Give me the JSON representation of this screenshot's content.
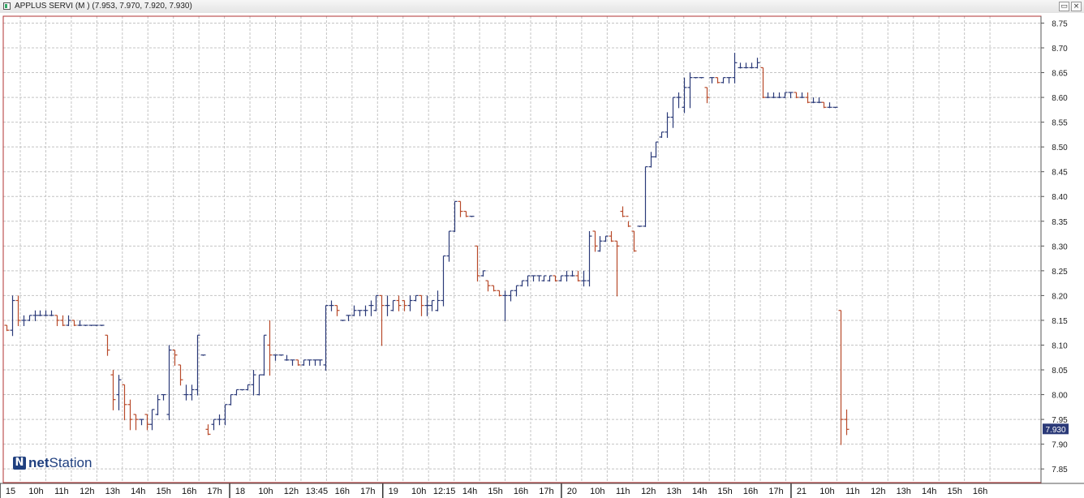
{
  "window": {
    "title": "APPLUS SERVI (M ) (7.953, 7.970, 7.920, 7.930)",
    "buttons": {
      "restore": "▭",
      "close": "×"
    }
  },
  "logo": {
    "part1": "net",
    "part2": "Station"
  },
  "colors": {
    "up": "#2b3a78",
    "down": "#b84a2a",
    "grid": "#c4c4c4",
    "frame": "#b03030",
    "last_price_bg": "#2b3a78",
    "last_price_text": "#ffffff"
  },
  "chart_data": {
    "type": "ohlc",
    "grid": true,
    "ylim": [
      7.83,
      8.77
    ],
    "yticks": [
      "7.85",
      "7.90",
      "7.95",
      "8.00",
      "8.05",
      "8.10",
      "8.15",
      "8.20",
      "8.25",
      "8.30",
      "8.35",
      "8.40",
      "8.45",
      "8.50",
      "8.55",
      "8.60",
      "8.65",
      "8.70",
      "8.75"
    ],
    "xlabels": [
      "15",
      "10h",
      "11h",
      "12h",
      "13h",
      "14h",
      "15h",
      "16h",
      "17h",
      "18",
      "10h",
      "12h",
      "13:45",
      "16h",
      "17h",
      "19",
      "10h",
      "12:15",
      "14h",
      "15h",
      "16h",
      "17h",
      "20",
      "10h",
      "11h",
      "12h",
      "13h",
      "14h",
      "15h",
      "16h",
      "17h",
      "21",
      "10h",
      "11h",
      "12h",
      "13h",
      "14h",
      "15h",
      "16h"
    ],
    "last_price": "7.930",
    "bars": [
      [
        8.14,
        8.14,
        8.13,
        8.13
      ],
      [
        8.13,
        8.2,
        8.12,
        8.19
      ],
      [
        8.19,
        8.2,
        8.14,
        8.15
      ],
      [
        8.15,
        8.16,
        8.14,
        8.15
      ],
      [
        8.15,
        8.16,
        8.15,
        8.16
      ],
      [
        8.16,
        8.17,
        8.15,
        8.16
      ],
      [
        8.16,
        8.17,
        8.16,
        8.16
      ],
      [
        8.16,
        8.17,
        8.16,
        8.16
      ],
      [
        8.16,
        8.17,
        8.16,
        8.16
      ],
      [
        8.16,
        8.16,
        8.14,
        8.15
      ],
      [
        8.15,
        8.16,
        8.14,
        8.14
      ],
      [
        8.14,
        8.16,
        8.14,
        8.15
      ],
      [
        8.15,
        8.15,
        8.14,
        8.14
      ],
      [
        8.14,
        8.15,
        8.14,
        8.14
      ],
      [
        8.14,
        8.14,
        8.14,
        8.14
      ],
      [
        8.14,
        8.14,
        8.14,
        8.14
      ],
      [
        8.14,
        8.14,
        8.14,
        8.14
      ],
      [
        8.14,
        8.14,
        8.14,
        8.14
      ],
      [
        8.12,
        8.12,
        8.08,
        8.09
      ],
      [
        8.04,
        8.05,
        7.97,
        7.99
      ],
      [
        8.0,
        8.04,
        7.97,
        8.03
      ],
      [
        8.02,
        8.02,
        7.95,
        7.98
      ],
      [
        7.98,
        7.99,
        7.93,
        7.95
      ],
      [
        7.96,
        7.96,
        7.93,
        7.95
      ],
      [
        7.95,
        7.95,
        7.94,
        7.95
      ],
      [
        7.96,
        7.96,
        7.93,
        7.94
      ],
      [
        7.94,
        7.97,
        7.93,
        7.97
      ],
      [
        7.96,
        8.0,
        7.96,
        7.99
      ],
      [
        8.0,
        8.0,
        7.99,
        8.0
      ],
      [
        7.96,
        8.1,
        7.95,
        8.09
      ],
      [
        8.09,
        8.09,
        8.06,
        8.08
      ],
      [
        8.06,
        8.06,
        8.02,
        8.03
      ],
      [
        8.0,
        8.02,
        7.99,
        8.0
      ],
      [
        8.0,
        8.02,
        7.99,
        8.01
      ],
      [
        8.01,
        8.12,
        8.0,
        8.12
      ],
      [
        8.08,
        8.08,
        8.08,
        8.08
      ],
      [
        7.93,
        7.94,
        7.92,
        7.92
      ],
      [
        7.94,
        7.95,
        7.93,
        7.95
      ],
      [
        7.95,
        7.96,
        7.94,
        7.95
      ],
      [
        7.95,
        7.98,
        7.94,
        7.98
      ],
      [
        7.98,
        8.0,
        7.98,
        8.0
      ],
      [
        8.0,
        8.01,
        8.0,
        8.01
      ],
      [
        8.01,
        8.01,
        8.01,
        8.01
      ],
      [
        8.01,
        8.02,
        8.01,
        8.02
      ],
      [
        8.02,
        8.05,
        8.0,
        8.04
      ],
      [
        8.0,
        8.04,
        8.0,
        8.04
      ],
      [
        8.04,
        8.12,
        8.04,
        8.12
      ],
      [
        8.1,
        8.15,
        8.04,
        8.08
      ],
      [
        8.08,
        8.08,
        8.07,
        8.08
      ],
      [
        8.08,
        8.08,
        8.08,
        8.08
      ],
      [
        8.07,
        8.08,
        8.07,
        8.07
      ],
      [
        8.07,
        8.07,
        8.06,
        8.07
      ],
      [
        8.07,
        8.07,
        8.06,
        8.06
      ],
      [
        8.06,
        8.07,
        8.06,
        8.07
      ],
      [
        8.07,
        8.07,
        8.06,
        8.07
      ],
      [
        8.07,
        8.07,
        8.06,
        8.07
      ],
      [
        8.07,
        8.07,
        8.06,
        8.07
      ],
      [
        8.06,
        8.18,
        8.05,
        8.18
      ],
      [
        8.18,
        8.19,
        8.17,
        8.18
      ],
      [
        8.18,
        8.18,
        8.16,
        8.17
      ],
      [
        8.15,
        8.15,
        8.15,
        8.15
      ],
      [
        8.16,
        8.16,
        8.15,
        8.16
      ],
      [
        8.16,
        8.18,
        8.16,
        8.17
      ],
      [
        8.17,
        8.17,
        8.16,
        8.17
      ],
      [
        8.17,
        8.18,
        8.16,
        8.17
      ],
      [
        8.18,
        8.19,
        8.16,
        8.18
      ],
      [
        8.17,
        8.2,
        8.17,
        8.2
      ],
      [
        8.2,
        8.2,
        8.1,
        8.18
      ],
      [
        8.18,
        8.2,
        8.16,
        8.18
      ],
      [
        8.17,
        8.19,
        8.17,
        8.19
      ],
      [
        8.19,
        8.2,
        8.17,
        8.18
      ],
      [
        8.19,
        8.19,
        8.17,
        8.18
      ],
      [
        8.18,
        8.2,
        8.17,
        8.19
      ],
      [
        8.19,
        8.2,
        8.19,
        8.2
      ],
      [
        8.2,
        8.2,
        8.16,
        8.18
      ],
      [
        8.18,
        8.2,
        8.16,
        8.18
      ],
      [
        8.18,
        8.19,
        8.17,
        8.19
      ],
      [
        8.17,
        8.21,
        8.17,
        8.19
      ],
      [
        8.19,
        8.28,
        8.18,
        8.28
      ],
      [
        8.28,
        8.33,
        8.27,
        8.33
      ],
      [
        8.33,
        8.39,
        8.33,
        8.39
      ],
      [
        8.39,
        8.39,
        8.36,
        8.37
      ],
      [
        8.37,
        8.37,
        8.36,
        8.36
      ],
      [
        8.36,
        8.36,
        8.36,
        8.36
      ],
      [
        8.3,
        8.3,
        8.23,
        8.24
      ],
      [
        8.24,
        8.25,
        8.24,
        8.25
      ],
      [
        8.23,
        8.23,
        8.21,
        8.22
      ],
      [
        8.22,
        8.22,
        8.21,
        8.21
      ],
      [
        8.21,
        8.21,
        8.2,
        8.2
      ],
      [
        8.2,
        8.21,
        8.15,
        8.2
      ],
      [
        8.2,
        8.21,
        8.19,
        8.21
      ],
      [
        8.21,
        8.22,
        8.2,
        8.22
      ],
      [
        8.22,
        8.23,
        8.22,
        8.23
      ],
      [
        8.23,
        8.24,
        8.22,
        8.24
      ],
      [
        8.24,
        8.24,
        8.23,
        8.24
      ],
      [
        8.24,
        8.24,
        8.23,
        8.24
      ],
      [
        8.23,
        8.24,
        8.23,
        8.24
      ],
      [
        8.23,
        8.24,
        8.23,
        8.24
      ],
      [
        8.24,
        8.24,
        8.23,
        8.23
      ],
      [
        8.23,
        8.24,
        8.23,
        8.24
      ],
      [
        8.24,
        8.25,
        8.23,
        8.24
      ],
      [
        8.24,
        8.25,
        8.24,
        8.24
      ],
      [
        8.24,
        8.25,
        8.23,
        8.23
      ],
      [
        8.23,
        8.25,
        8.22,
        8.23
      ],
      [
        8.23,
        8.33,
        8.22,
        8.32
      ],
      [
        8.33,
        8.33,
        8.29,
        8.3
      ],
      [
        8.29,
        8.32,
        8.29,
        8.31
      ],
      [
        8.31,
        8.32,
        8.31,
        8.32
      ],
      [
        8.32,
        8.33,
        8.31,
        8.31
      ],
      [
        8.31,
        8.31,
        8.2,
        8.3
      ],
      [
        8.37,
        8.38,
        8.36,
        8.36
      ],
      [
        8.36,
        8.35,
        8.34,
        8.34
      ],
      [
        8.33,
        8.33,
        8.29,
        8.29
      ],
      [
        8.34,
        8.34,
        8.34,
        8.34
      ],
      [
        8.34,
        8.46,
        8.34,
        8.46
      ],
      [
        8.46,
        8.49,
        8.46,
        8.48
      ],
      [
        8.48,
        8.51,
        8.48,
        8.51
      ],
      [
        8.52,
        8.53,
        8.52,
        8.53
      ],
      [
        8.53,
        8.57,
        8.52,
        8.56
      ],
      [
        8.56,
        8.6,
        8.54,
        8.6
      ],
      [
        8.6,
        8.61,
        8.58,
        8.6
      ],
      [
        8.58,
        8.64,
        8.57,
        8.62
      ],
      [
        8.62,
        8.65,
        8.58,
        8.64
      ],
      [
        8.64,
        8.64,
        8.64,
        8.64
      ],
      [
        8.64,
        8.64,
        8.64,
        8.64
      ],
      [
        8.62,
        8.62,
        8.59,
        8.6
      ],
      [
        8.64,
        8.64,
        8.63,
        8.64
      ],
      [
        8.64,
        8.64,
        8.63,
        8.63
      ],
      [
        8.63,
        8.64,
        8.63,
        8.64
      ],
      [
        8.64,
        8.64,
        8.63,
        8.64
      ],
      [
        8.64,
        8.69,
        8.63,
        8.67
      ],
      [
        8.66,
        8.67,
        8.66,
        8.66
      ],
      [
        8.66,
        8.67,
        8.66,
        8.66
      ],
      [
        8.66,
        8.67,
        8.66,
        8.66
      ],
      [
        8.66,
        8.68,
        8.66,
        8.67
      ],
      [
        8.66,
        8.66,
        8.6,
        8.6
      ],
      [
        8.6,
        8.61,
        8.6,
        8.6
      ],
      [
        8.6,
        8.61,
        8.6,
        8.6
      ],
      [
        8.6,
        8.61,
        8.6,
        8.6
      ],
      [
        8.6,
        8.61,
        8.6,
        8.61
      ],
      [
        8.61,
        8.61,
        8.6,
        8.61
      ],
      [
        8.61,
        8.61,
        8.6,
        8.6
      ],
      [
        8.6,
        8.61,
        8.6,
        8.6
      ],
      [
        8.6,
        8.61,
        8.59,
        8.59
      ],
      [
        8.59,
        8.6,
        8.59,
        8.59
      ],
      [
        8.59,
        8.6,
        8.59,
        8.59
      ],
      [
        8.59,
        8.59,
        8.58,
        8.58
      ],
      [
        8.58,
        8.59,
        8.58,
        8.58
      ],
      [
        8.58,
        8.58,
        8.58,
        8.58
      ],
      [
        8.17,
        8.17,
        7.9,
        7.95
      ],
      [
        7.95,
        7.97,
        7.92,
        7.93
      ]
    ]
  }
}
